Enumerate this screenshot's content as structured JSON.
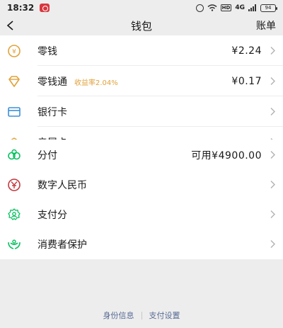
{
  "status_bar": {
    "time": "18:32",
    "hd": "HD",
    "network": "4G",
    "battery": "94"
  },
  "nav": {
    "title": "钱包",
    "action": "账单"
  },
  "section1": {
    "items": [
      {
        "label": "零钱",
        "value": "¥2.24"
      },
      {
        "label": "零钱通",
        "tag": "收益率2.04%",
        "value": "¥0.17"
      },
      {
        "label": "银行卡"
      },
      {
        "label": "亲属卡"
      }
    ]
  },
  "section2": {
    "items": [
      {
        "label": "分付",
        "value": "可用¥4900.00"
      }
    ]
  },
  "section3": {
    "items": [
      {
        "label": "数字人民币"
      },
      {
        "label": "支付分"
      },
      {
        "label": "消费者保护"
      }
    ]
  },
  "footer": {
    "identity": "身份信息",
    "settings": "支付设置"
  },
  "colors": {
    "gold": "#e0a23b",
    "green": "#07c160",
    "blue": "#3b8fd9",
    "red": "#c2393f",
    "link": "#576b95"
  }
}
